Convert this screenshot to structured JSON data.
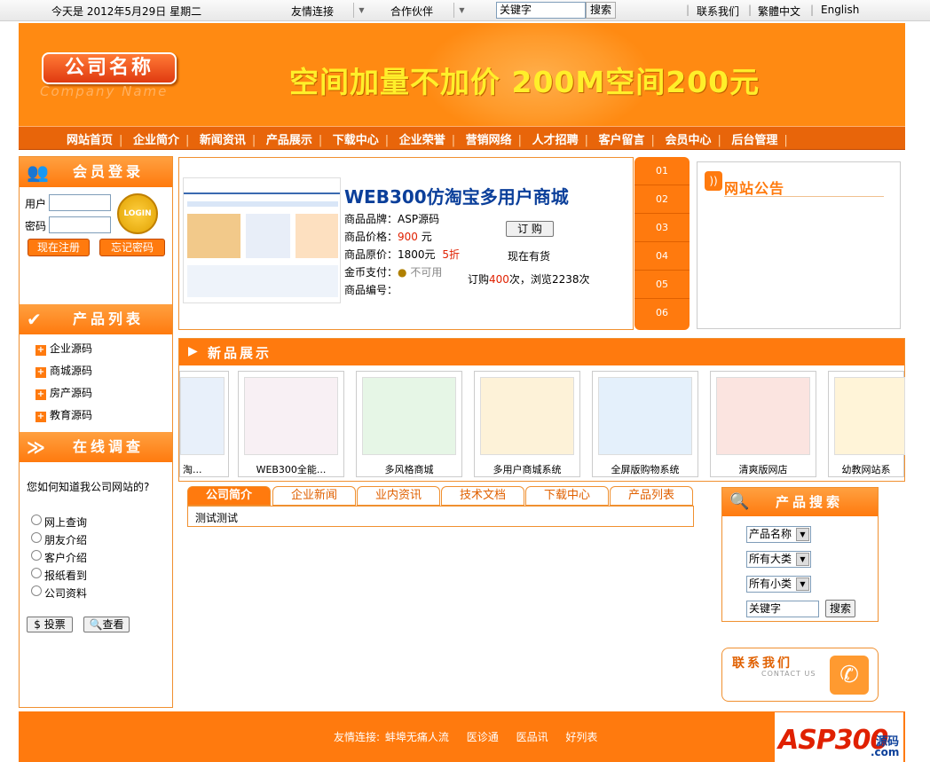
{
  "topbar": {
    "date": "今天是 2012年5月29日 星期二",
    "friend_links": "友情连接",
    "partners": "合作伙伴",
    "keyword_value": "关键字",
    "search_btn": "搜索",
    "contact": "联系我们",
    "traditional": "繁體中文",
    "english": "English"
  },
  "header": {
    "logo_cn": "公司名称",
    "logo_en": "Company Name",
    "slogan": "空间加量不加价 200M空间200元"
  },
  "nav": [
    "网站首页",
    "企业简介",
    "新闻资讯",
    "产品展示",
    "下载中心",
    "企业荣誉",
    "营销网络",
    "人才招聘",
    "客户留言",
    "会员中心",
    "后台管理"
  ],
  "login": {
    "title": "会员登录",
    "user_label": "用户",
    "pass_label": "密码",
    "login_btn": "LOGIN",
    "register_btn": "现在注册",
    "forgot_btn": "忘记密码"
  },
  "product_list": {
    "title": "产品列表",
    "items": [
      "企业源码",
      "商城源码",
      "房产源码",
      "教育源码"
    ]
  },
  "survey": {
    "title": "在线调查",
    "question": "您如何知道我公司网站的?",
    "options": [
      "网上查询",
      "朋友介绍",
      "客户介绍",
      "报纸看到",
      "公司资料"
    ],
    "vote_btn": "投票",
    "view_btn": "查看"
  },
  "featured": {
    "title": "WEB300仿淘宝多用户商城",
    "brand_label": "商品品牌：",
    "brand": "ASP源码",
    "price_label": "商品价格：",
    "price": "900",
    "price_unit": "元",
    "orig_label": "商品原价：",
    "orig": "1800元",
    "discount": "5折",
    "coin_label": "金币支付：",
    "coin": "不可用",
    "code_label": "商品编号：",
    "order_btn": "订 购",
    "stock": "现在有货",
    "stats_a": "订购",
    "orders": "400",
    "stats_b": "次，浏览",
    "views": "2238",
    "stats_c": "次"
  },
  "num_tabs": [
    "01",
    "02",
    "03",
    "04",
    "05",
    "06"
  ],
  "notice": {
    "title": "网站公告"
  },
  "new_products": {
    "title": "新品展示",
    "items": [
      "淘...",
      "WEB300全能...",
      "多风格商城",
      "多用户商城系统",
      "全屏版购物系统",
      "清爽版网店",
      "幼教网站系"
    ]
  },
  "tabs": {
    "labels": [
      "公司简介",
      "企业新闻",
      "业内资讯",
      "技术文档",
      "下载中心",
      "产品列表"
    ],
    "content": "测试测试"
  },
  "product_search": {
    "title": "产品搜索",
    "select1": "产品名称",
    "select2": "所有大类",
    "select3": "所有小类",
    "keyword": "关键字",
    "search_btn": "搜索"
  },
  "contact_box": {
    "cn": "联系我们",
    "en": "CONTACT US"
  },
  "footer": {
    "label": "友情连接:",
    "links": [
      "蚌埠无痛人流",
      "医诊通",
      "医品讯",
      "好列表"
    ]
  },
  "watermark": {
    "text": "ASP300",
    "suffix": "源码",
    "domain": ".com"
  },
  "colors": {
    "brand": "#ff7a0e",
    "nav": "#e8650a",
    "slogan": "#ffef2a",
    "title_blue": "#0b3f9a",
    "price_red": "#e02000"
  }
}
